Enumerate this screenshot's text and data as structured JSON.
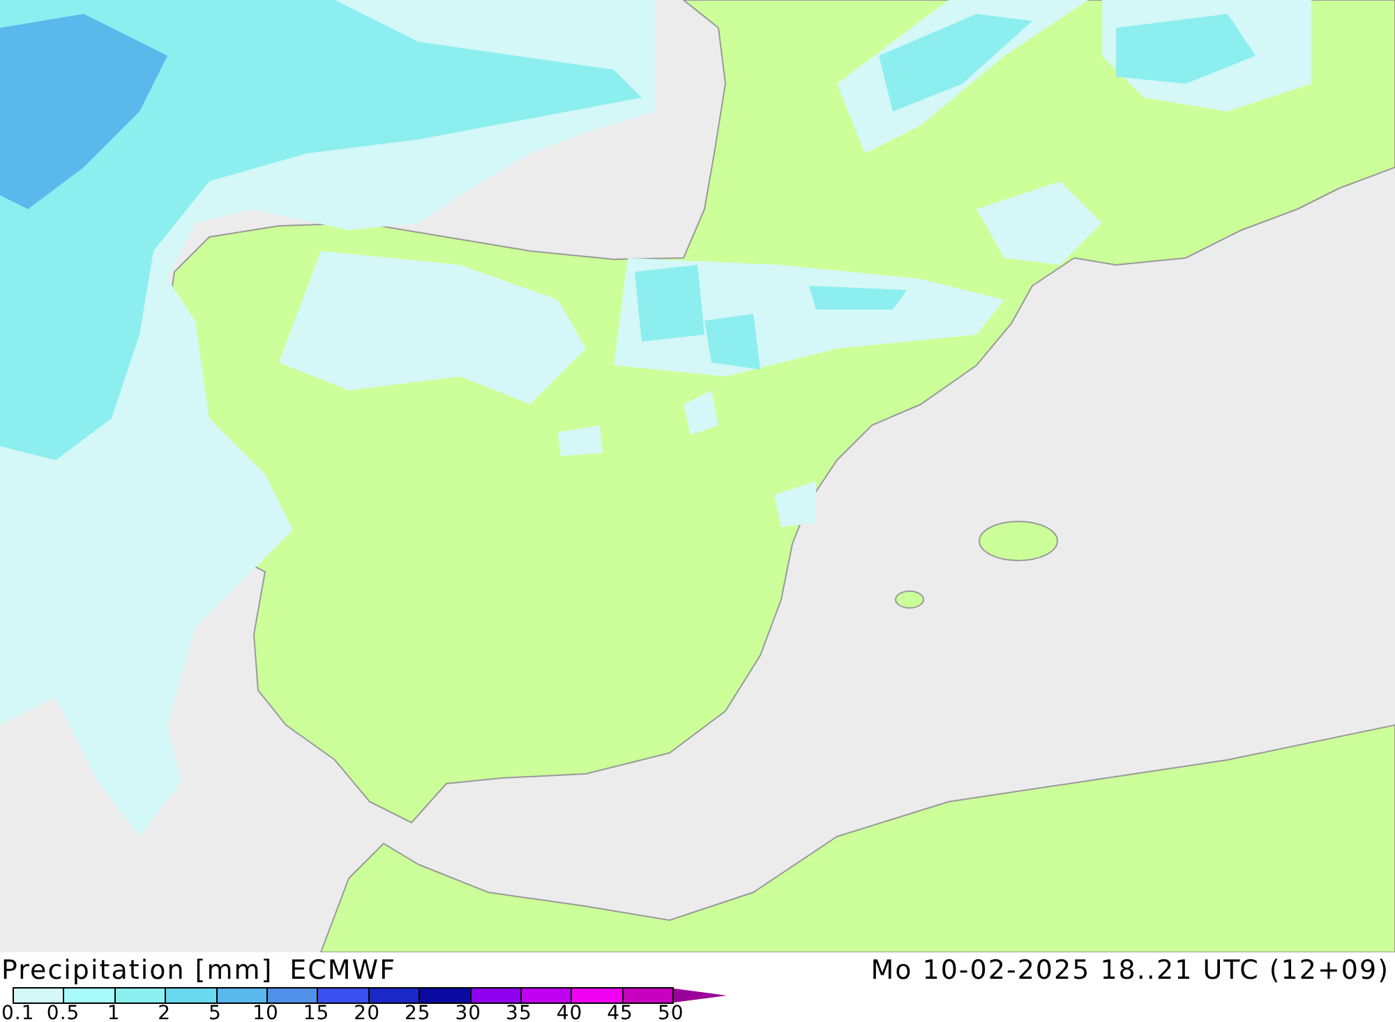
{
  "title": "Precipitation [mm]",
  "model": "ECMWF",
  "valid_time": "Mo 10-02-2025 18..21 UTC (12+09)",
  "legend": {
    "swatches": [
      {
        "color": "#d4f7f7"
      },
      {
        "color": "#a8fafa"
      },
      {
        "color": "#8ceeee"
      },
      {
        "color": "#6ad8ee"
      },
      {
        "color": "#5ab8ec"
      },
      {
        "color": "#5090e8"
      },
      {
        "color": "#3c50f0"
      },
      {
        "color": "#1a28c8"
      },
      {
        "color": "#0a0aa0"
      },
      {
        "color": "#9000f0"
      },
      {
        "color": "#c000f0"
      },
      {
        "color": "#f000f0"
      },
      {
        "color": "#c800c0"
      },
      {
        "kind": "arrow",
        "color": "#9a009a"
      }
    ],
    "ticks": [
      "0.1",
      "0.5",
      "1",
      "2",
      "5",
      "10",
      "15",
      "20",
      "25",
      "30",
      "35",
      "40",
      "45",
      "50"
    ]
  }
}
